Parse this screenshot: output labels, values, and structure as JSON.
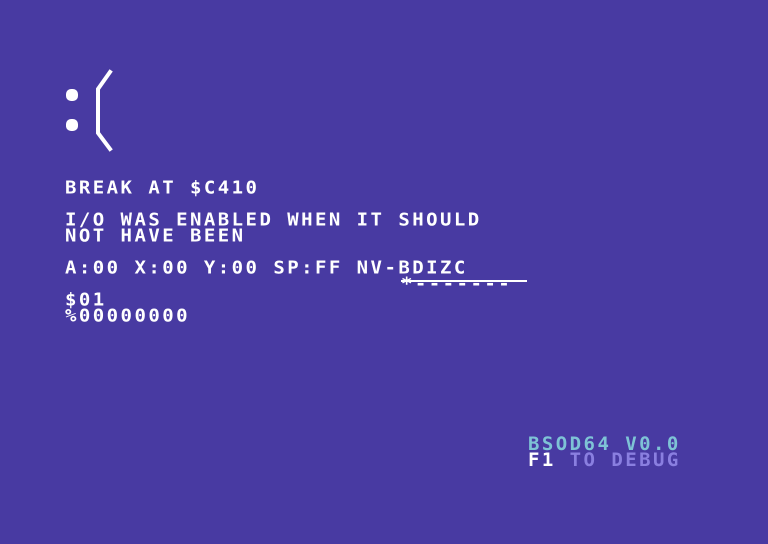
{
  "break_message": "BREAK AT $C410",
  "error_line1": "I/O WAS ENABLED WHEN IT SHOULD",
  "error_line2": "NOT HAVE BEEN",
  "registers": "A:00 X:00 Y:00 SP:FF NV-BDIZC",
  "flags_bits": "*-------",
  "port_hex": "$01",
  "port_bin": "%00000000",
  "version": "BSOD64 V0.0",
  "f1_key": "F1",
  "debug_hint": " TO DEBUG",
  "colors": {
    "background": "#483aa2",
    "text": "#ffffff",
    "title_accent": "#7ec3d6",
    "hint_accent": "#8a7fe0"
  },
  "icon": "sad-face-icon"
}
